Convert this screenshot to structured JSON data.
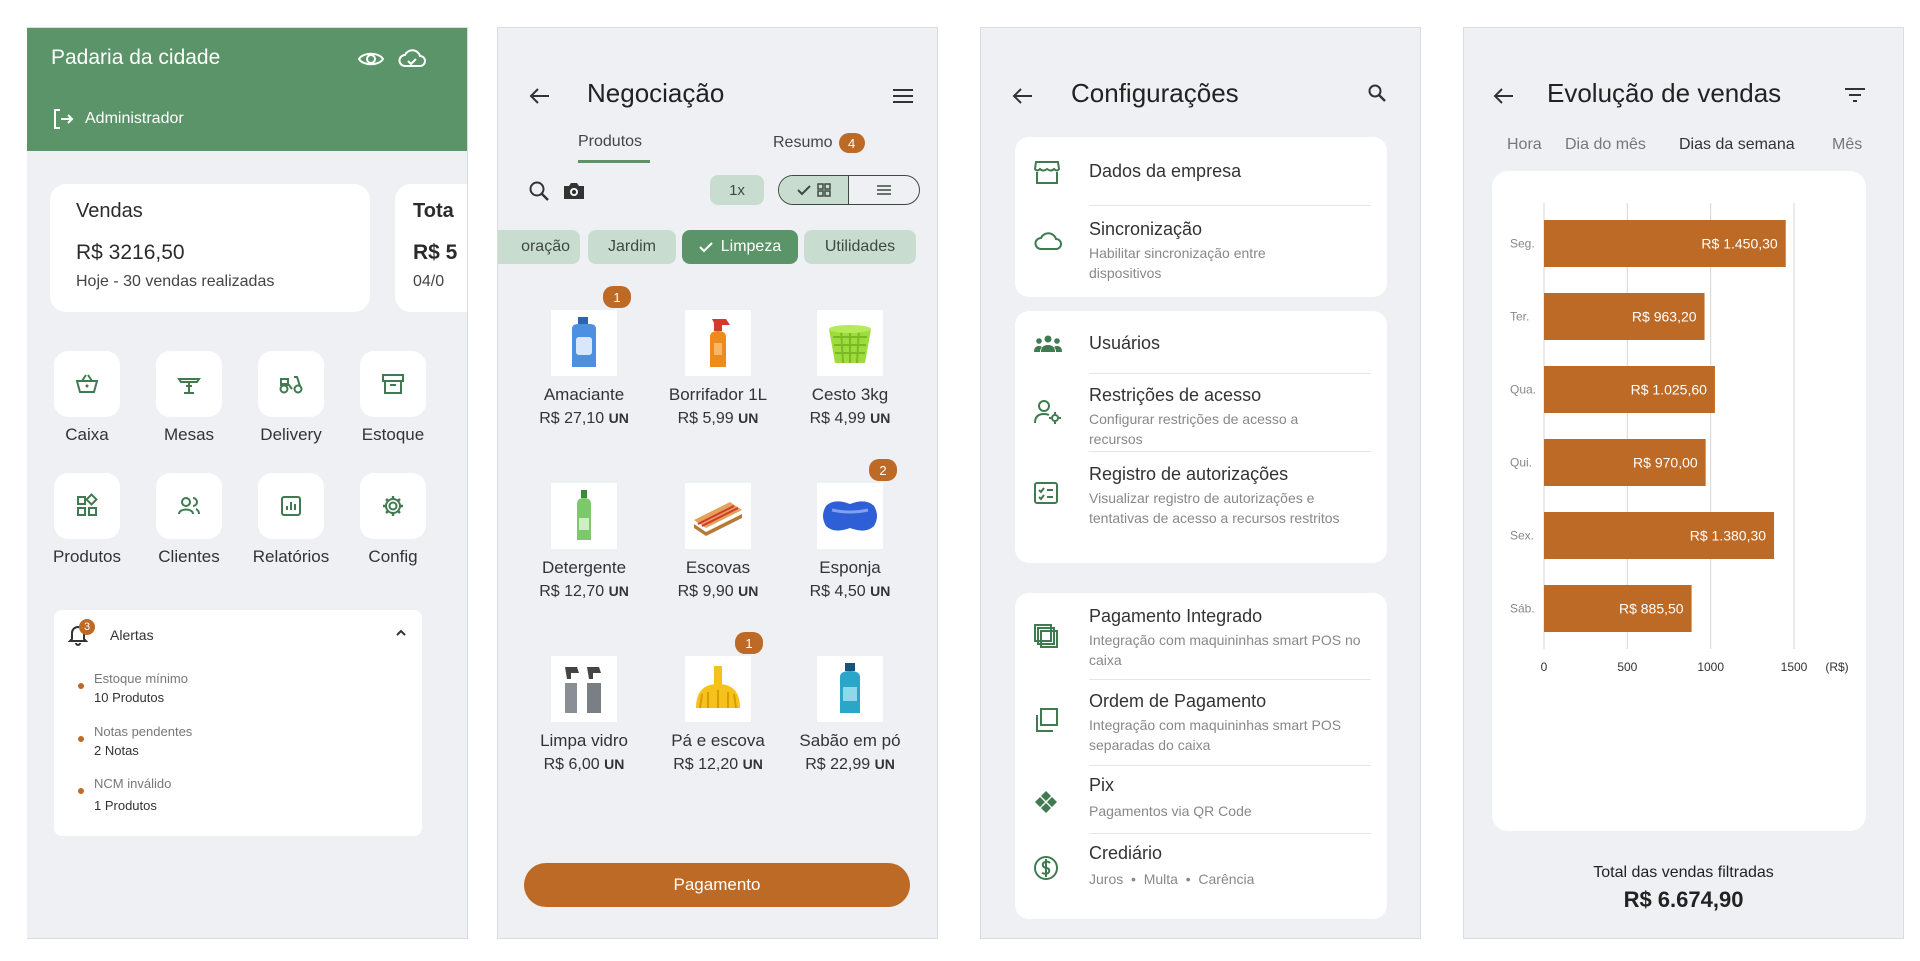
{
  "home": {
    "business_name": "Padaria da cidade",
    "user_label": "Administrador",
    "sales_card": {
      "title": "Vendas",
      "value": "R$ 3216,50",
      "subtitle": "Hoje - 30 vendas realizadas"
    },
    "total_card": {
      "title": "Tota",
      "value": "R$ 5",
      "subtitle": "04/0"
    },
    "tiles": [
      {
        "label": "Caixa",
        "icon": "basket-icon"
      },
      {
        "label": "Mesas",
        "icon": "table-icon"
      },
      {
        "label": "Delivery",
        "icon": "scooter-icon"
      },
      {
        "label": "Estoque",
        "icon": "archive-icon"
      },
      {
        "label": "Produtos",
        "icon": "grid-icon"
      },
      {
        "label": "Clientes",
        "icon": "users-icon"
      },
      {
        "label": "Relatórios",
        "icon": "report-icon"
      },
      {
        "label": "Config",
        "icon": "gear-icon"
      }
    ],
    "alerts": {
      "title": "Alertas",
      "count": "3",
      "items": [
        {
          "title": "Estoque mínimo",
          "value": "10 Produtos"
        },
        {
          "title": "Notas pendentes",
          "value": "2 Notas"
        },
        {
          "title": "NCM inválido",
          "value": "1 Produtos"
        }
      ]
    }
  },
  "negotiation": {
    "title": "Negociação",
    "tabs": {
      "products": "Produtos",
      "summary": "Resumo",
      "summary_count": "4"
    },
    "multiplier": "1x",
    "categories": [
      "oração",
      "Jardim",
      "Limpeza",
      "Utilidades"
    ],
    "active_category": "Limpeza",
    "products": [
      {
        "name": "Amaciante",
        "price": "R$ 27,10",
        "unit": "UN",
        "qty": "1",
        "icon": "softener-bottle-icon"
      },
      {
        "name": "Borrifador 1L",
        "price": "R$ 5,99",
        "unit": "UN",
        "qty": "",
        "icon": "spray-bottle-icon"
      },
      {
        "name": "Cesto 3kg",
        "price": "R$ 4,99",
        "unit": "UN",
        "qty": "",
        "icon": "basket-product-icon"
      },
      {
        "name": "Detergente",
        "price": "R$ 12,70",
        "unit": "UN",
        "qty": "",
        "icon": "detergent-icon"
      },
      {
        "name": "Escovas",
        "price": "R$ 9,90",
        "unit": "UN",
        "qty": "",
        "icon": "brush-icon"
      },
      {
        "name": "Esponja",
        "price": "R$ 4,50",
        "unit": "UN",
        "qty": "2",
        "icon": "sponge-icon"
      },
      {
        "name": "Limpa vidro",
        "price": "R$ 6,00",
        "unit": "UN",
        "qty": "",
        "icon": "glass-cleaner-icon"
      },
      {
        "name": "Pá e escova",
        "price": "R$ 12,20",
        "unit": "UN",
        "qty": "1",
        "icon": "dustpan-icon"
      },
      {
        "name": "Sabão em pó",
        "price": "R$ 22,99",
        "unit": "UN",
        "qty": "",
        "icon": "soap-powder-icon"
      }
    ],
    "pay_button": "Pagamento"
  },
  "settings": {
    "title": "Configurações",
    "groups": [
      [
        {
          "title": "Dados da empresa",
          "desc": "",
          "icon": "store-icon"
        },
        {
          "title": "Sincronização",
          "desc": "Habilitar sincronização entre dispositivos",
          "icon": "cloud-icon"
        }
      ],
      [
        {
          "title": "Usuários",
          "desc": "",
          "icon": "users-icon"
        },
        {
          "title": "Restrições de acesso",
          "desc": "Configurar restrições de acesso a recursos",
          "icon": "user-gear-icon"
        },
        {
          "title": "Registro de autorizações",
          "desc": "Visualizar registro de autorizações e tentativas de acesso a recursos restritos",
          "icon": "checklist-icon"
        }
      ],
      [
        {
          "title": "Pagamento Integrado",
          "desc": "Integração com maquininhas smart POS no caixa",
          "icon": "pos-stack-icon"
        },
        {
          "title": "Ordem de Pagamento",
          "desc": "Integração com maquininhas smart POS separadas do caixa",
          "icon": "copy-icon"
        },
        {
          "title": "Pix",
          "desc": "Pagamentos via QR Code",
          "icon": "pix-icon"
        },
        {
          "title": "Crediário",
          "desc": "Juros  •  Multa  •  Carência",
          "icon": "dollar-circle-icon"
        }
      ]
    ]
  },
  "sales": {
    "title": "Evolução de vendas",
    "filter_tabs": [
      "Hora",
      "Dia do mês",
      "Dias da semana",
      "Mês"
    ],
    "active_tab": "Dias da semana",
    "total_label": "Total das vendas filtradas",
    "total_value": "R$ 6.674,90",
    "colors": {
      "bar": "#bd6a27",
      "accent": "#5a9468"
    }
  },
  "chart_data": {
    "type": "bar",
    "orientation": "horizontal",
    "categories": [
      "Seg.",
      "Ter.",
      "Qua.",
      "Qui.",
      "Sex.",
      "Sáb."
    ],
    "values": [
      1450.3,
      963.2,
      1025.6,
      970.0,
      1380.3,
      885.5
    ],
    "data_labels": [
      "R$ 1.450,30",
      "R$ 963,20",
      "R$ 1.025,60",
      "R$ 970,00",
      "R$ 1.380,30",
      "R$ 885,50"
    ],
    "x_ticks": [
      "0",
      "500",
      "1000",
      "1500"
    ],
    "x_unit": "(R$)",
    "xlim": [
      0,
      1500
    ],
    "grid": true
  }
}
